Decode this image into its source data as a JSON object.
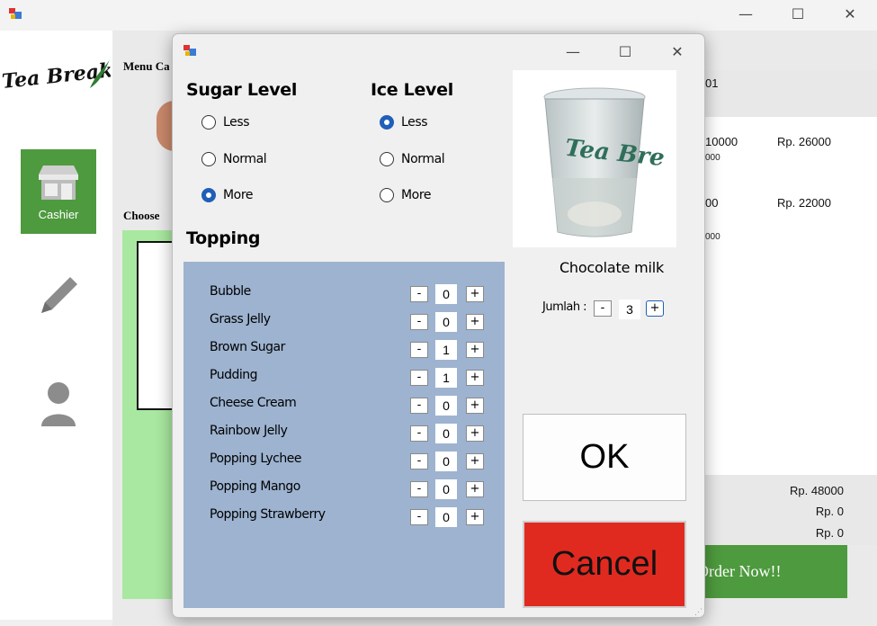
{
  "background": {
    "window_controls": {
      "minimize": "—",
      "maximize": "☐",
      "close": "✕"
    },
    "logo_text": "Tea Break",
    "sidebar": {
      "cashier_label": "Cashier"
    },
    "menu_label": "Menu Ca",
    "choose_label": "Choose",
    "order_header_fragment": "01",
    "order_items": [
      {
        "price_fragment": "10000",
        "sub_fragment": "000",
        "total": "Rp. 26000"
      },
      {
        "price_fragment": "00",
        "sub_fragment": "000",
        "total": "Rp. 22000"
      }
    ],
    "totals": [
      "Rp. 48000",
      "Rp. 0",
      "Rp. 0"
    ],
    "order_now_label": "Order Now!!"
  },
  "dialog": {
    "window_controls": {
      "minimize": "—",
      "maximize": "☐",
      "close": "✕"
    },
    "sugar_level": {
      "title": "Sugar Level",
      "options": [
        "Less",
        "Normal",
        "More"
      ],
      "selected": "More"
    },
    "ice_level": {
      "title": "Ice Level",
      "options": [
        "Less",
        "Normal",
        "More"
      ],
      "selected": "Less"
    },
    "topping": {
      "title": "Topping",
      "items": [
        {
          "name": "Bubble",
          "qty": "0"
        },
        {
          "name": "Grass Jelly",
          "qty": "0"
        },
        {
          "name": "Brown Sugar",
          "qty": "1"
        },
        {
          "name": "Pudding",
          "qty": "1"
        },
        {
          "name": "Cheese Cream",
          "qty": "0"
        },
        {
          "name": "Rainbow Jelly",
          "qty": "0"
        },
        {
          "name": "Popping Lychee",
          "qty": "0"
        },
        {
          "name": "Popping Mango",
          "qty": "0"
        },
        {
          "name": "Popping Strawberry",
          "qty": "0"
        }
      ],
      "minus_label": "-",
      "plus_label": "+"
    },
    "product": {
      "name": "Chocolate milk",
      "cup_logo": "Tea Bre"
    },
    "jumlah": {
      "label": "Jumlah :",
      "value": "3",
      "minus_label": "-",
      "plus_label": "+"
    },
    "ok_label": "OK",
    "cancel_label": "Cancel"
  },
  "colors": {
    "accent_green": "#4e9a3e",
    "topping_panel": "#9db3d0",
    "cancel_red": "#e02a20",
    "radio_selected": "#1f5fb8"
  }
}
